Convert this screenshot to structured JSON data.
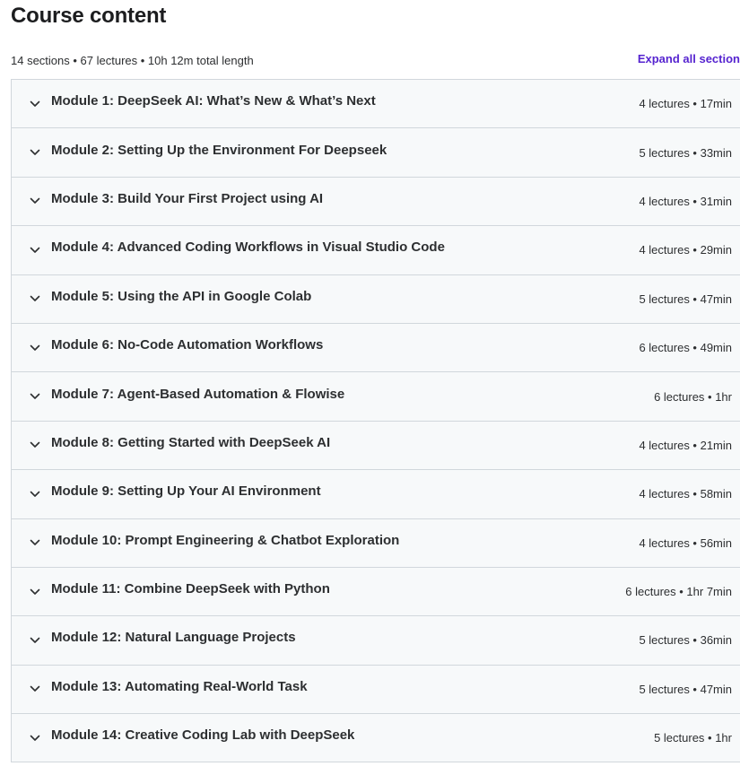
{
  "header": {
    "title": "Course content",
    "summary": "14 sections • 67 lectures • 10h 12m total length",
    "expand_all_label": "Expand all section"
  },
  "icons": {
    "section_toggle": "chevron-down-icon"
  },
  "colors": {
    "accent": "#5624d0",
    "section_bg": "#f7f9fa",
    "border": "#d1d7dc",
    "text": "#2d2f31"
  },
  "sections": [
    {
      "title": "Module 1: DeepSeek AI: What’s New & What’s Next",
      "meta": "4 lectures • 17min"
    },
    {
      "title": "Module 2: Setting Up the Environment For Deepseek",
      "meta": "5 lectures • 33min"
    },
    {
      "title": "Module 3: Build Your First Project using AI",
      "meta": "4 lectures • 31min"
    },
    {
      "title": "Module 4: Advanced Coding Workflows in Visual Studio Code",
      "meta": "4 lectures • 29min"
    },
    {
      "title": "Module 5: Using the API in Google Colab",
      "meta": "5 lectures • 47min"
    },
    {
      "title": "Module 6: No-Code Automation Workflows",
      "meta": "6 lectures • 49min"
    },
    {
      "title": "Module 7: Agent-Based Automation & Flowise",
      "meta": "6 lectures • 1hr"
    },
    {
      "title": "Module 8: Getting Started with DeepSeek AI",
      "meta": "4 lectures • 21min"
    },
    {
      "title": "Module 9: Setting Up Your AI Environment",
      "meta": "4 lectures • 58min"
    },
    {
      "title": "Module 10: Prompt Engineering & Chatbot Exploration",
      "meta": "4 lectures • 56min"
    },
    {
      "title": "Module 11: Combine DeepSeek with Python",
      "meta": "6 lectures • 1hr 7min"
    },
    {
      "title": "Module 12: Natural Language Projects",
      "meta": "5 lectures • 36min"
    },
    {
      "title": "Module 13: Automating Real-World Task",
      "meta": "5 lectures • 47min"
    },
    {
      "title": "Module 14: Creative Coding Lab with DeepSeek",
      "meta": "5 lectures • 1hr"
    }
  ]
}
